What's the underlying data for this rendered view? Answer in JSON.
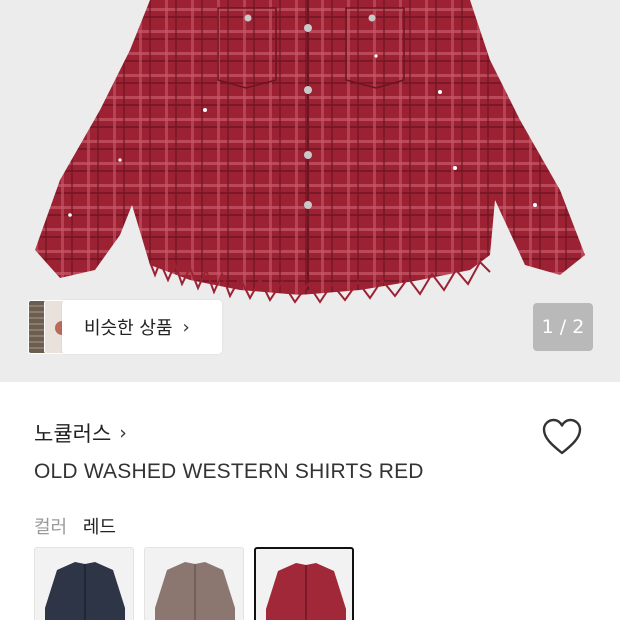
{
  "hero": {
    "image_alt": "red plaid western shirt",
    "pager": "1 / 2"
  },
  "similar": {
    "label": "비슷한 상품",
    "chevron": "›"
  },
  "product": {
    "brand": "노큘러스",
    "brand_chevron": "›",
    "title": "OLD WASHED WESTERN SHIRTS RED",
    "favorite_icon": "heart-outline-icon"
  },
  "color": {
    "label": "컬러",
    "selected": "레드"
  },
  "swatches": [
    {
      "name": "navy",
      "color": "#2d3546",
      "selected": false
    },
    {
      "name": "brown",
      "color": "#8b7670",
      "selected": false
    },
    {
      "name": "red",
      "color": "#a12838",
      "selected": true
    }
  ],
  "colors": {
    "shirt_red": "#9c2233",
    "hero_bg": "#ececec",
    "pager_bg": "#b9b9b9"
  }
}
